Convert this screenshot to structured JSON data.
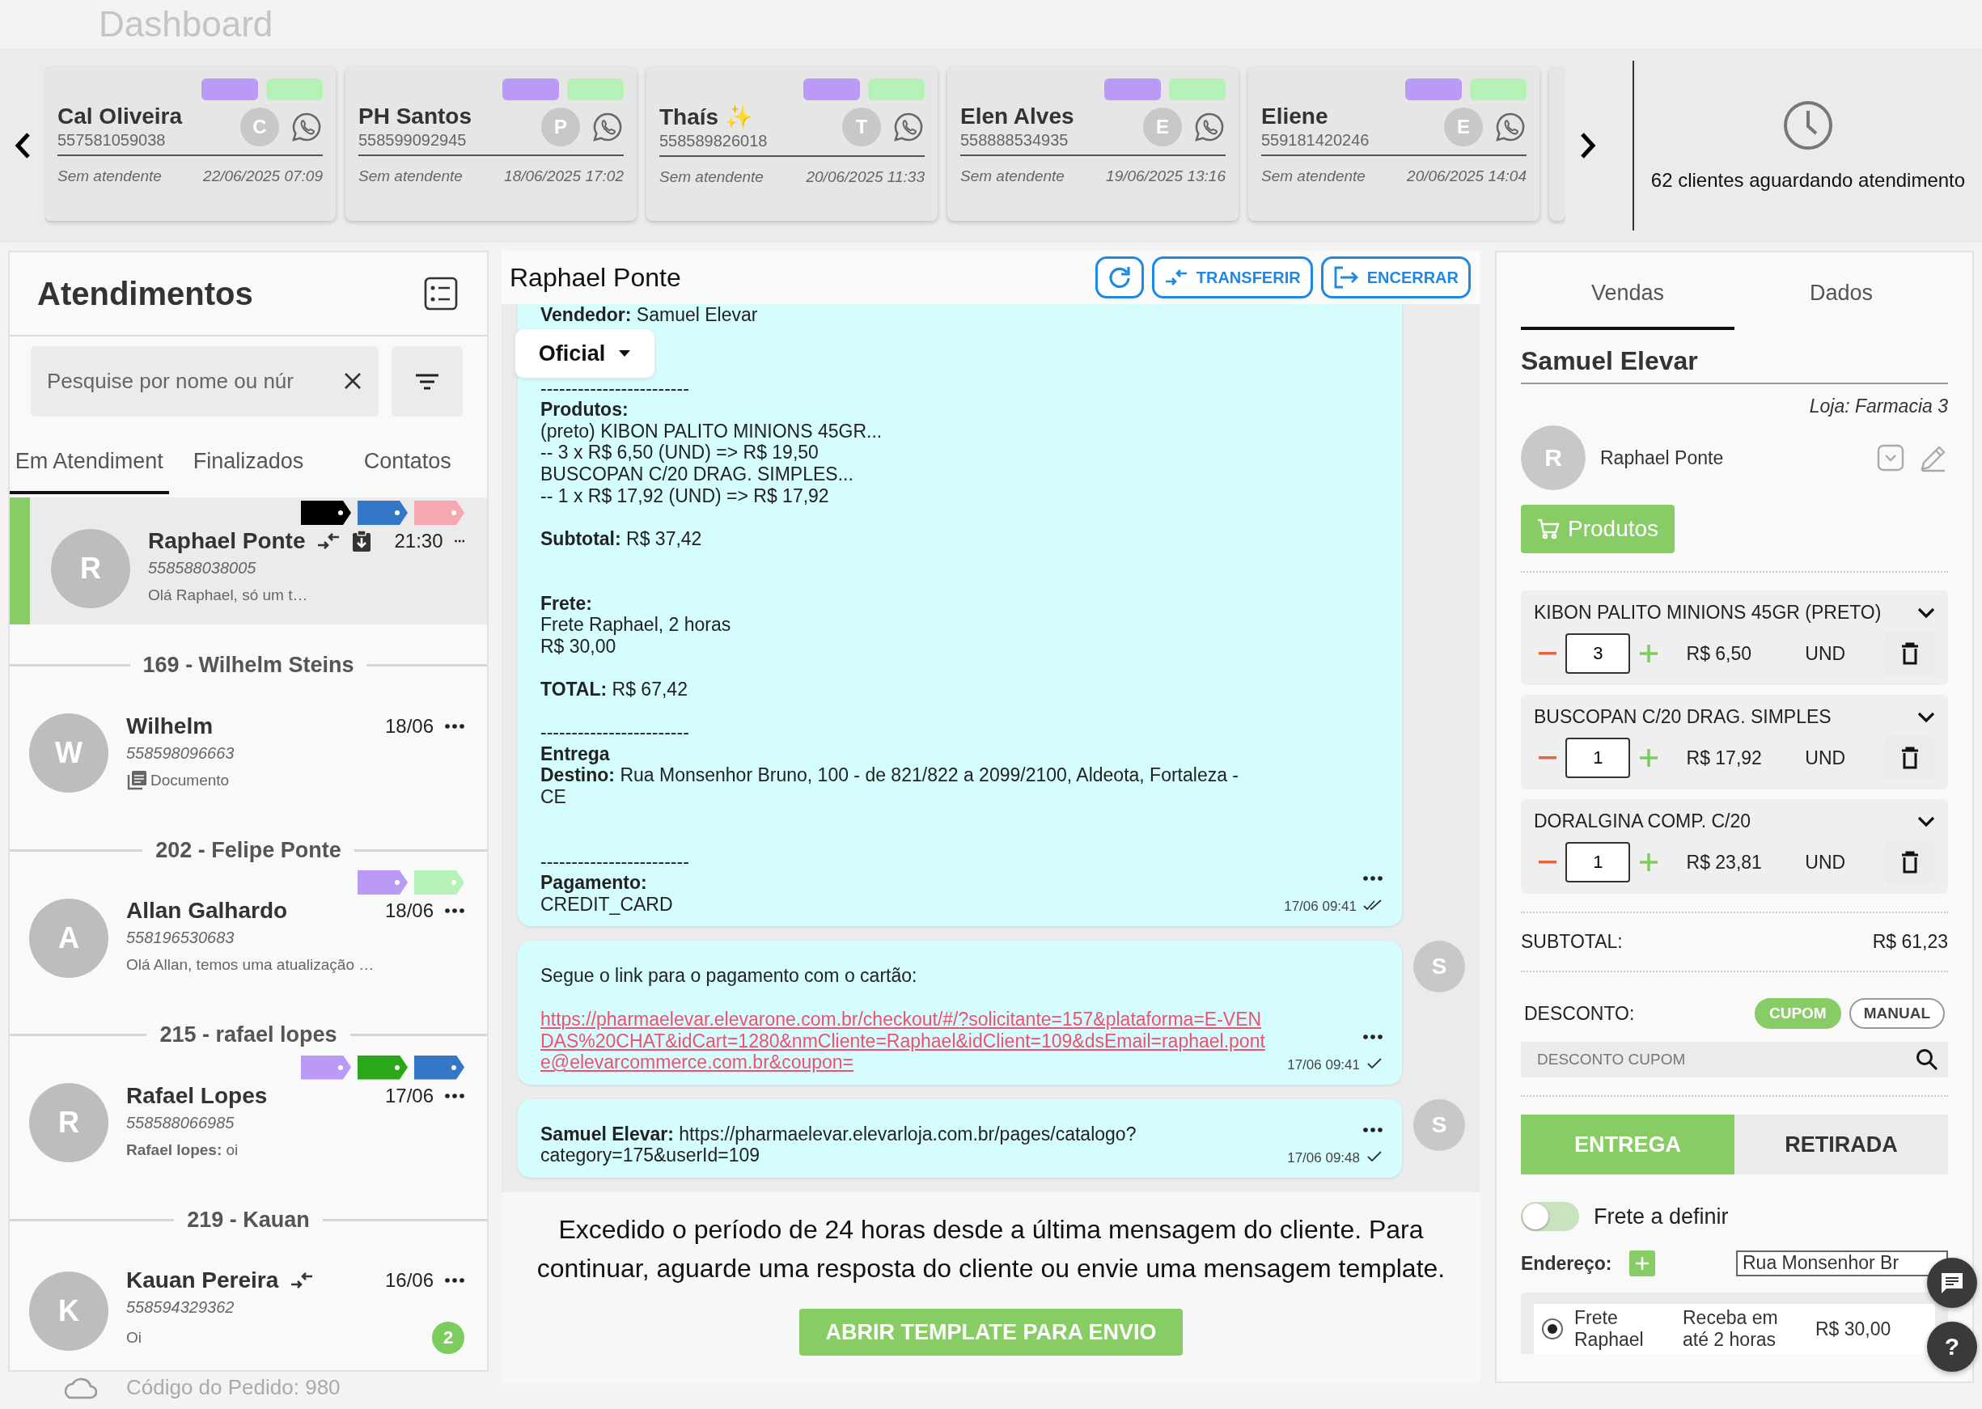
{
  "header": {
    "title": "Dashboard"
  },
  "queue": {
    "cards": [
      {
        "name": "Cal Oliveira",
        "phone": "557581059038",
        "avatar": "C",
        "tags": [
          {
            "color": "#bb9af7"
          },
          {
            "color": "#b6f2b8"
          }
        ],
        "agent": "Sem atendente",
        "date": "22/06/2025 07:09"
      },
      {
        "name": "PH Santos",
        "phone": "558599092945",
        "avatar": "P",
        "tags": [
          {
            "color": "#bb9af7"
          },
          {
            "color": "#b6f2b8"
          }
        ],
        "agent": "Sem atendente",
        "date": "18/06/2025 17:02"
      },
      {
        "name": "Thaís ✨",
        "phone": "558589826018",
        "avatar": "T",
        "tags": [
          {
            "color": "#bb9af7"
          },
          {
            "color": "#b6f2b8"
          }
        ],
        "agent": "Sem atendente",
        "date": "20/06/2025 11:33"
      },
      {
        "name": "Elen Alves",
        "phone": "558888534935",
        "avatar": "E",
        "tags": [
          {
            "color": "#bb9af7"
          },
          {
            "color": "#b6f2b8"
          }
        ],
        "agent": "Sem atendente",
        "date": "19/06/2025 13:16"
      },
      {
        "name": "Eliene",
        "phone": "559181420246",
        "avatar": "E",
        "tags": [
          {
            "color": "#bb9af7"
          },
          {
            "color": "#b6f2b8"
          }
        ],
        "agent": "Sem atendente",
        "date": "20/06/2025 14:04"
      }
    ],
    "waiting": "62 clientes aguardando atendimento"
  },
  "sidebar": {
    "title": "Atendimentos",
    "search": {
      "placeholder": "Pesquise por nome ou núr"
    },
    "tabs": [
      {
        "label": "Em Atendiment",
        "selected": true
      },
      {
        "label": "Finalizados",
        "selected": false
      },
      {
        "label": "Contatos",
        "selected": false
      }
    ],
    "conversations": [
      {
        "name": "Raphael Ponte",
        "avatar": "R",
        "phone": "558588038005",
        "time": "21:30",
        "preview": "Olá Raphael, só um t…",
        "transferred": true,
        "has_order": true,
        "tags": [
          {
            "color": "#000000"
          },
          {
            "color": "#3477c7"
          },
          {
            "color": "#f6a8b0"
          }
        ],
        "selected": true
      },
      {
        "group": "169 - Wilhelm Steins",
        "name": "Wilhelm",
        "avatar": "W",
        "phone": "558598096663",
        "time": "18/06",
        "preview": "Documento",
        "has_document": true,
        "selected": false
      },
      {
        "group": "202 - Felipe Ponte",
        "tags": [
          {
            "color": "#bb9af7"
          },
          {
            "color": "#b6f2b8"
          }
        ],
        "name": "Allan Galhardo",
        "avatar": "A",
        "phone": "558196530683",
        "time": "18/06",
        "preview": "Olá Allan, temos uma atualização …",
        "selected": false
      },
      {
        "group": "215 - rafael lopes",
        "tags": [
          {
            "color": "#bb9af7"
          },
          {
            "color": "#2aa81a"
          },
          {
            "color": "#3477c7"
          }
        ],
        "name": "Rafael Lopes",
        "avatar": "R",
        "phone": "558588066985",
        "time": "17/06",
        "preview": "**Rafael lopes:** oi",
        "selected": false
      },
      {
        "group": "219 - Kauan",
        "name": "Kauan Pereira",
        "avatar": "K",
        "phone": "558594329362",
        "time": "16/06",
        "transferred": true,
        "preview": "Oi",
        "unread": "2",
        "selected": false
      }
    ],
    "footer": "Código do Pedido: 980"
  },
  "chat": {
    "title": "Raphael Ponte",
    "actions": [
      {
        "kind": "refresh"
      },
      {
        "kind": "transfer",
        "label": "TRANSFERIR"
      },
      {
        "kind": "close",
        "label": "ENCERRAR"
      }
    ],
    "channel": "Oficial",
    "messages": [
      {
        "header": "**Vendedor:** Samuel Elevar",
        "text": "------------------------\n**Produtos:**\n(preto) KIBON PALITO MINIONS 45GR...\n-- 3 x R$ 6,50 (UND) => R$ 19,50\nBUSCOPAN C/20 DRAG. SIMPLES...\n-- 1 x R$ 17,92 (UND) => R$ 17,92\n\n**Subtotal:** R$ 37,42\n\n\n**Frete:**\nFrete Raphael, 2 horas\nR$ 30,00\n\n**TOTAL:** R$ 67,42\n\n------------------------\n**Entrega**\n**Destino:** Rua Monsenhor Bruno, 100 - de 821/822 a 2099/2100, Aldeota, Fortaleza -\nCE\n\n\n------------------------\n**Pagamento:**\nCREDIT_CARD",
        "time": "17/06 09:41",
        "read": true
      },
      {
        "text": "Segue o link para o pagamento com o cartão:",
        "link": "https://pharmaelevar.elevarone.com.br/checkout/#/?solicitante=157&plataforma=E-VENDAS%20CHAT&idCart=1280&nmCliente=Raphael&idClient=109&dsEmail=raphael.ponte@elevarcommerce.com.br&coupon=",
        "time": "17/06 09:41",
        "read": false,
        "avatar": "S"
      },
      {
        "text": "**Samuel Elevar:** https://pharmaelevar.elevarloja.com.br/pages/catalogo?\ncategory=175&userId=109",
        "time": "17/06 09:48",
        "read": false,
        "avatar": "S"
      }
    ],
    "notice": "Excedido o período de 24 horas desde a última mensagem do cliente. Para continuar, aguarde uma resposta do cliente ou envie uma mensagem template.",
    "template_button": "ABRIR TEMPLATE PARA ENVIO"
  },
  "sales": {
    "tabs": [
      {
        "label": "Vendas",
        "selected": true
      },
      {
        "label": "Dados",
        "selected": false
      }
    ],
    "seller": "Samuel Elevar",
    "store": "Loja: Farmacia 3",
    "customer": {
      "avatar": "R",
      "name": "Raphael Ponte"
    },
    "products_button": "Produtos",
    "items": [
      {
        "name": "KIBON PALITO MINIONS 45GR (PRETO)",
        "qty": "3",
        "price": "R$ 6,50",
        "unit": "UND"
      },
      {
        "name": "BUSCOPAN C/20 DRAG. SIMPLES",
        "qty": "1",
        "price": "R$ 17,92",
        "unit": "UND"
      },
      {
        "name": "DORALGINA COMP. C/20",
        "qty": "1",
        "price": "R$ 23,81",
        "unit": "UND"
      }
    ],
    "subtotal": {
      "label": "SUBTOTAL:",
      "value": "R$ 61,23"
    },
    "discount": {
      "label": "DESCONTO:",
      "modes": [
        {
          "label": "CUPOM",
          "selected": true
        },
        {
          "label": "MANUAL",
          "selected": false
        }
      ],
      "placeholder": "DESCONTO CUPOM"
    },
    "delivery": [
      {
        "label": "ENTREGA",
        "selected": true
      },
      {
        "label": "RETIRADA",
        "selected": false
      }
    ],
    "frete_toggle": {
      "label": "Frete a definir",
      "on": false
    },
    "address": {
      "label": "Endereço:",
      "value": "Rua Monsenhor Br"
    },
    "shipping": [
      {
        "name": "Frete Raphael",
        "eta": "Receba em até 2 horas",
        "price": "R$ 30,00",
        "selected": true
      }
    ],
    "help": "?"
  }
}
